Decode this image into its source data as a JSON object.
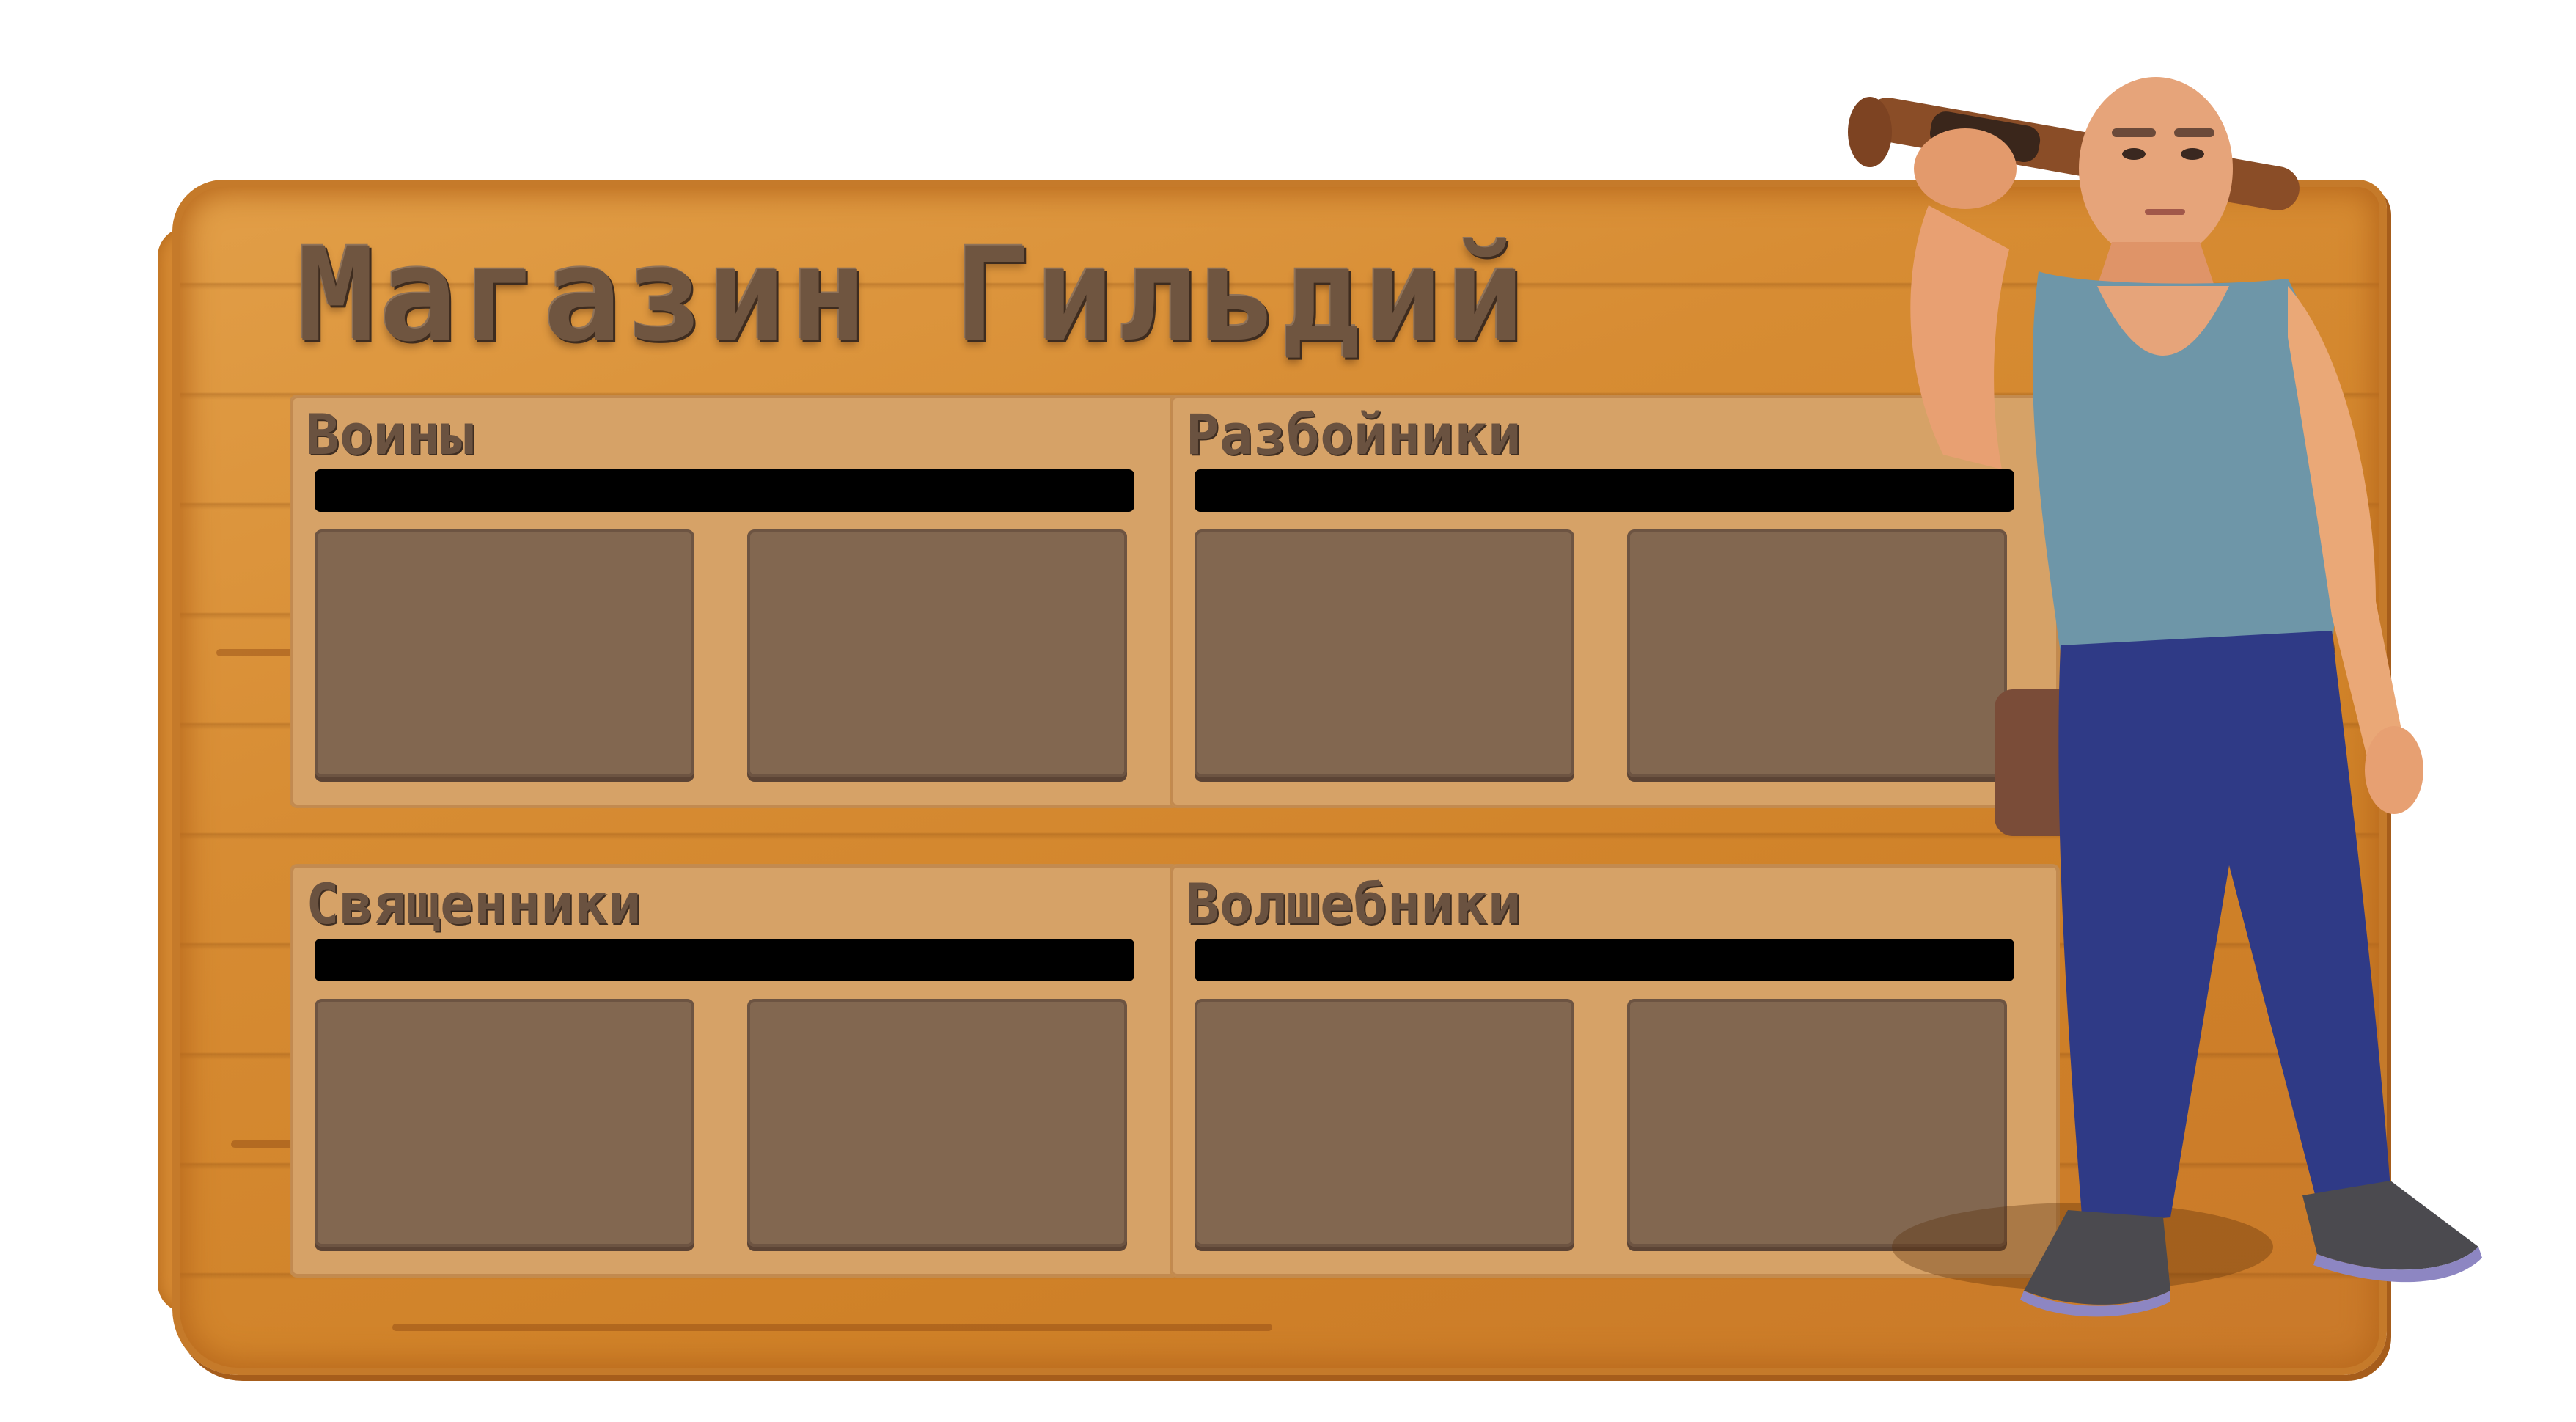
{
  "shop": {
    "title": "Магазин Гильдий",
    "guilds": [
      {
        "name": "Воины"
      },
      {
        "name": "Разбойники"
      },
      {
        "name": "Священники"
      },
      {
        "name": "Волшебники"
      }
    ]
  },
  "colors": {
    "wood": "#d78c33",
    "panel": "#d6a267",
    "slot": "#826750",
    "title_text": "#6f5540",
    "bar": "#000000"
  },
  "icons": {
    "character": "guild-merchant-character"
  }
}
